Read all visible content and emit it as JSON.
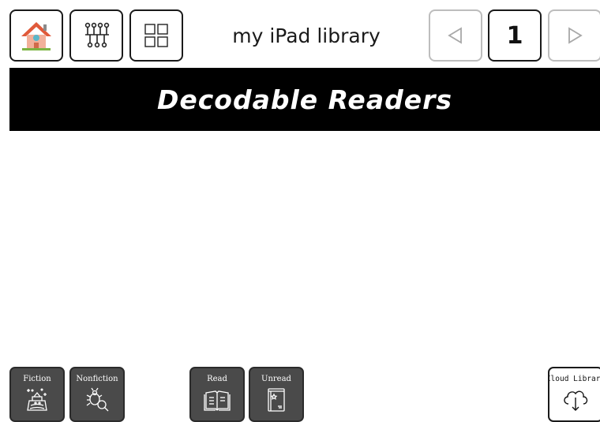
{
  "header": {
    "title": "my iPad library",
    "page_number": "1"
  },
  "banner": {
    "title": "Decodable Readers"
  },
  "filters": {
    "fiction": "Fiction",
    "nonfiction": "Nonfiction",
    "read": "Read",
    "unread": "Unread",
    "cloud_library": "Cloud Library"
  },
  "icons": {
    "home": "house-icon",
    "tree": "hierarchy-icon",
    "grid": "grid-icon",
    "prev": "triangle-left-icon",
    "next": "triangle-right-icon",
    "fiction": "magic-castle-icon",
    "nonfiction": "bug-magnifier-icon",
    "read": "open-book-icon",
    "unread": "closed-book-icon",
    "cloud": "cloud-download-icon"
  },
  "colors": {
    "banner_bg": "#000000",
    "filter_bg": "#4a4a4a",
    "house_roof": "#e05a3a",
    "house_wall": "#f2b09a",
    "house_window": "#5ab7c9",
    "house_ground": "#7cb342"
  }
}
